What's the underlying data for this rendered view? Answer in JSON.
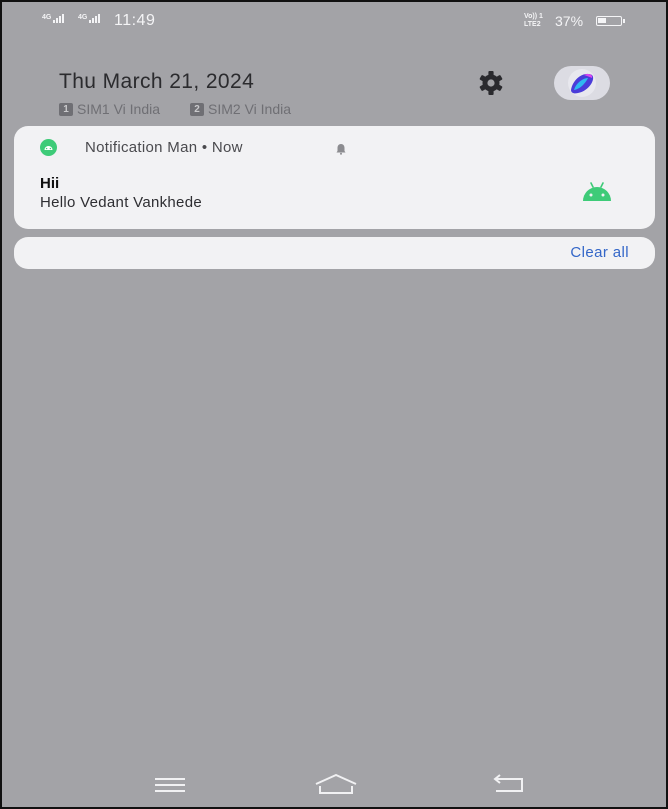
{
  "status_bar": {
    "sim1_net": "4G",
    "sim2_net": "4G",
    "time": "11:49",
    "lte_top": "Vo)) 1",
    "lte_bottom": "LTE2",
    "battery_text": "37%",
    "battery_level": 0.37
  },
  "header": {
    "date": "Thu March 21, 2024",
    "sims": [
      {
        "badge": "1",
        "label": "SIM1 Vi India"
      },
      {
        "badge": "2",
        "label": "SIM2 Vi India"
      }
    ],
    "settings_icon": "gear-icon",
    "avatar_icon": "theme-avatar-icon"
  },
  "notification": {
    "app_line": "Notification Man • Now",
    "title": "Hii",
    "text": "Hello Vedant Vankhede",
    "app_icon": "android-icon",
    "bell_icon": "bell-icon",
    "accent": "#3ecb78"
  },
  "actions": {
    "clear_all": "Clear all",
    "clear_color": "#3366c8"
  },
  "nav_bar": {
    "icons": [
      "menu-icon",
      "home-icon",
      "back-icon"
    ]
  },
  "colors": {
    "shade": "#a3a3a7",
    "card": "#f2f2f4"
  }
}
